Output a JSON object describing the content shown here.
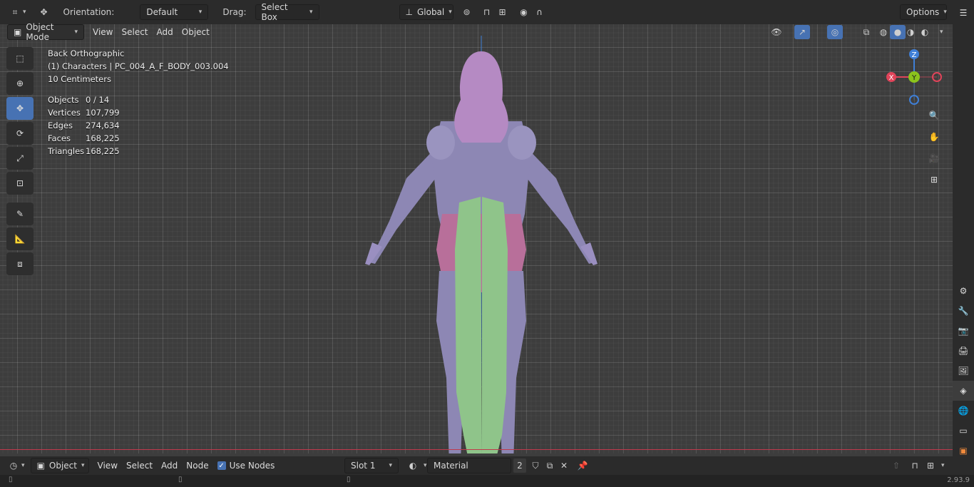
{
  "tool_header": {
    "orientation_label": "Orientation:",
    "orientation_value": "Default",
    "drag_label": "Drag:",
    "drag_value": "Select Box",
    "transform_orientation": "Global",
    "options_label": "Options"
  },
  "viewport_header": {
    "mode": "Object Mode",
    "menus": [
      "View",
      "Select",
      "Add",
      "Object"
    ]
  },
  "overlay": {
    "view_name": "Back Orthographic",
    "collection_object": "(1) Characters | PC_004_A_F_BODY_003.004",
    "grid_scale": "10 Centimeters",
    "stats": [
      {
        "label": "Objects",
        "value": "0 / 14"
      },
      {
        "label": "Vertices",
        "value": "107,799"
      },
      {
        "label": "Edges",
        "value": "274,634"
      },
      {
        "label": "Faces",
        "value": "168,225"
      },
      {
        "label": "Triangles",
        "value": "168,225"
      }
    ]
  },
  "gizmo": {
    "x": "X",
    "y": "Y",
    "z": "Z"
  },
  "node_header": {
    "editor_type": "Object",
    "menus": [
      "View",
      "Select",
      "Add",
      "Node"
    ],
    "use_nodes_label": "Use Nodes",
    "slot": "Slot 1",
    "material_name": "Material",
    "users_count": "2"
  },
  "status": {
    "version": "2.93.9"
  },
  "colors": {
    "accent": "#4772b3",
    "axis_x": "#e0445a",
    "axis_y": "#8bc41c",
    "axis_z": "#3f7fd6",
    "body_purple": "#8d87b4",
    "hood_lilac": "#b58ac3",
    "cloth_green": "#8fc48a",
    "skin_pink": "#b86f9a"
  }
}
